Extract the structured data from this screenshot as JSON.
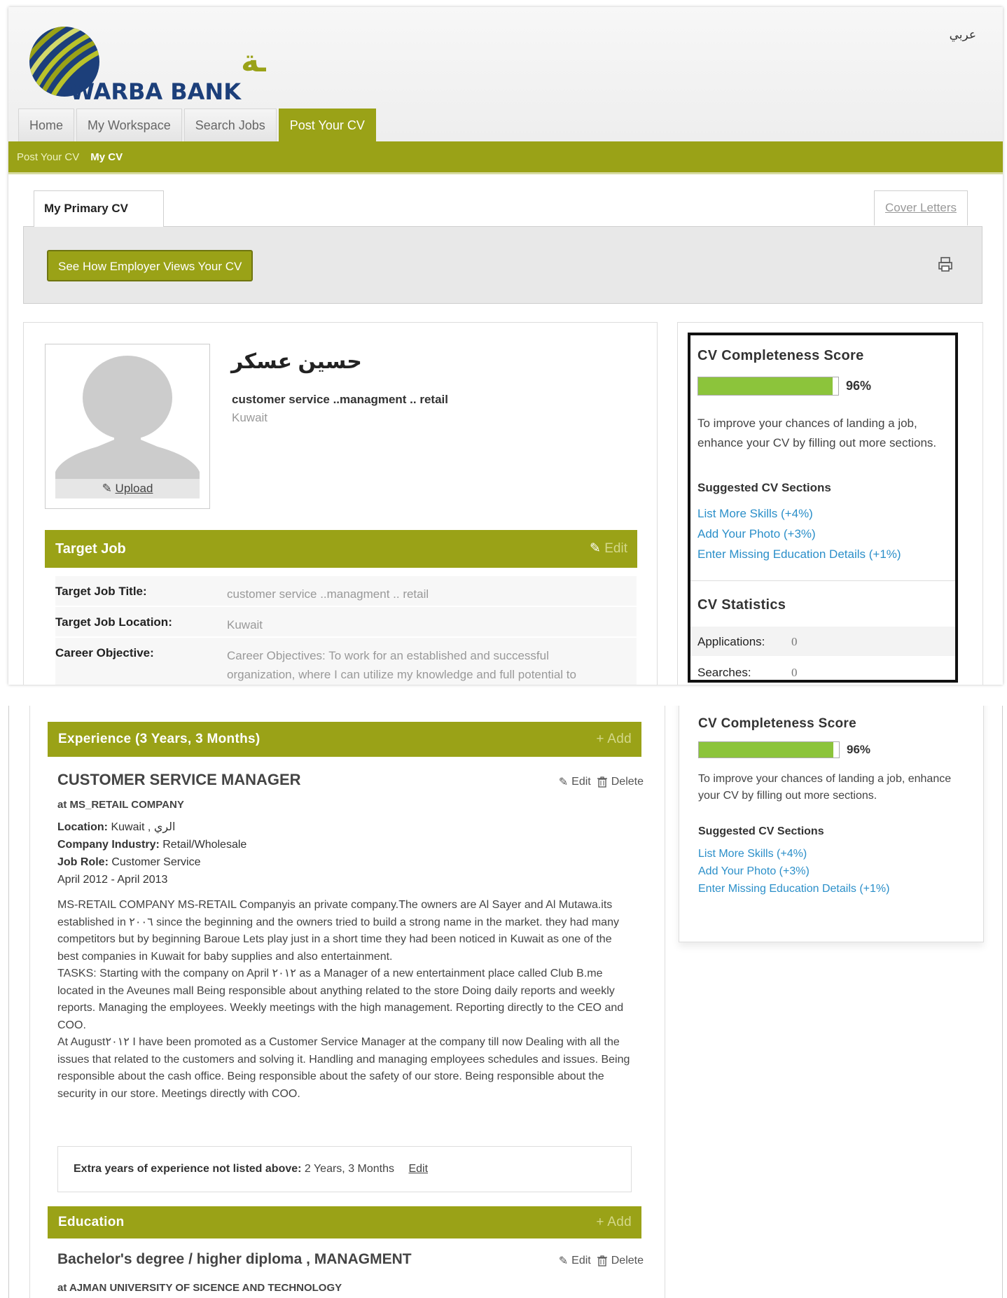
{
  "header": {
    "language_link": "عربي",
    "logo_arabic": "بنــك وربـــة",
    "logo_english": "WARBA BANK"
  },
  "nav": {
    "tabs": [
      {
        "label": "Home"
      },
      {
        "label": "My Workspace"
      },
      {
        "label": "Search Jobs"
      },
      {
        "label": "Post Your CV",
        "active": true
      }
    ]
  },
  "subnav": {
    "items": [
      "Post Your CV",
      "My CV"
    ]
  },
  "cv_tabs": {
    "primary": "My Primary CV",
    "cover_letters": "Cover Letters"
  },
  "actions": {
    "employer_view": "See How Employer Views Your CV"
  },
  "profile": {
    "name": "حسين عسكر",
    "headline": "customer service ..managment .. retail",
    "location": "Kuwait",
    "upload_label": "Upload"
  },
  "target_job": {
    "title": "Target Job",
    "edit_label": "Edit",
    "rows": [
      {
        "key": "Target Job Title:",
        "value": "customer service ..managment .. retail"
      },
      {
        "key": "Target Job Location:",
        "value": "Kuwait"
      },
      {
        "key": "Career Objective:",
        "value": "Career Objectives: To work for an established and successful organization, where I can utilize my knowledge and full potential to"
      }
    ]
  },
  "completeness": {
    "title": "CV Completeness Score",
    "percent": 96,
    "percent_label": "96%",
    "improve_text": "To improve your chances of landing a job, enhance your CV by filling out more sections.",
    "suggested_title": "Suggested CV Sections",
    "suggestions": [
      "List More Skills (+4%)",
      "Add Your Photo (+3%)",
      "Enter Missing Education Details (+1%)"
    ],
    "stats_title": "CV Statistics",
    "stats": [
      {
        "label": "Applications:",
        "value": "0"
      },
      {
        "label": "Searches:",
        "value": "0"
      }
    ]
  },
  "experience": {
    "title": "Experience (3 Years, 3 Months)",
    "add_label": "Add",
    "edit_label": "Edit",
    "delete_label": "Delete",
    "job": {
      "title": "CUSTOMER SERVICE MANAGER",
      "company": "at MS_RETAIL COMPANY",
      "location_label": "Location:",
      "location_value": "Kuwait , الري",
      "industry_label": "Company Industry:",
      "industry_value": "Retail/Wholesale",
      "role_label": "Job Role:",
      "role_value": "Customer Service",
      "dates": "April 2012 - April 2013",
      "description_1": "MS-RETAIL COMPANY MS-RETAIL Companyis an private company.The owners are Al Sayer and Al Mutawa.its established in ٢٠٠٦ since the beginning and the owners tried to build a strong name in the market. they had many competitors but by beginning Baroue Lets play just in a short time they had been noticed in Kuwait as one of the best companies in Kuwait for baby supplies and also entertainment.",
      "description_2": "TASKS: Starting with the company on April ٢٠١٢ as a Manager of a new entertainment place called Club B.me located in the Aveunes mall  Being responsible about anything related to the store  Doing daily reports and weekly reports.  Managing the employees.  Weekly meetings with the high management.  Reporting directly to the CEO and COO.",
      "description_3": "At August٢٠١٢ I have been promoted as a Customer Service Manager at the company till now  Dealing with all the issues that related to the customers and solving it.  Handling and managing employees schedules and issues.  Being responsible about the cash office.  Being responsible about the safety of our store.  Being responsible about the security in our store.  Meetings directly with COO."
    },
    "extra_label": "Extra years of experience not listed above:",
    "extra_value": "2 Years, 3 Months",
    "extra_edit": "Edit"
  },
  "education": {
    "title": "Education",
    "add_label": "Add",
    "edit_label": "Edit",
    "delete_label": "Delete",
    "degree": "Bachelor's degree / higher diploma , MANAGMENT",
    "school": "at AJMAN UNIVERSITY OF SICENCE AND TECHNOLOGY"
  },
  "colors": {
    "brand_green": "#9aa217",
    "progress_green": "#8cc43b",
    "link_blue": "#2b8fc9"
  }
}
